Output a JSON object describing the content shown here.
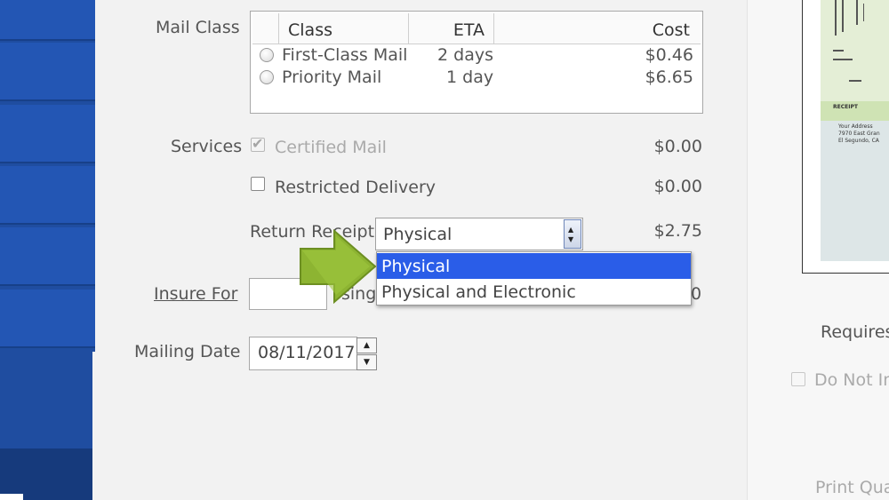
{
  "form": {
    "mail_class_label": "Mail Class",
    "mail_class_table": {
      "headers": [
        "Class",
        "ETA",
        "Cost"
      ],
      "rows": [
        {
          "class": "First-Class Mail",
          "eta": "2 days",
          "cost": "$0.46"
        },
        {
          "class": "Priority Mail",
          "eta": "1 day",
          "cost": "$6.65"
        }
      ]
    },
    "services_label": "Services",
    "certified_mail": {
      "label": "Certified Mail",
      "price": "$0.00",
      "checked": true,
      "disabled": true
    },
    "restricted_delivery": {
      "label": "Restricted Delivery",
      "price": "$0.00",
      "checked": false
    },
    "return_receipt": {
      "label": "Return Receipt",
      "selected": "Physical",
      "price": "$2.75",
      "options": [
        "Physical",
        "Physical and Electronic"
      ]
    },
    "insure_for": {
      "label": "Insure For",
      "value": "",
      "partial_text": "sing",
      "partial_price": "0"
    },
    "mailing_date": {
      "label": "Mailing Date",
      "value": "08/11/2017"
    }
  },
  "right_panel": {
    "preview_receipt_label": "RECEIPT",
    "preview_address_lines": [
      "Your Address",
      "7970 East Gran",
      "El Segundo, CA"
    ],
    "requires_label": "Requires",
    "do_not_label": "Do Not In",
    "print_label": "Print Qua"
  },
  "icons": {
    "pointer_arrow": "green-arrow-icon",
    "select_spinner": "updown-icon",
    "stepper_up": "up-icon",
    "stepper_down": "down-icon"
  },
  "colors": {
    "sidebar": "#1f4da0",
    "selection": "#2a5de8",
    "arrow": "#8db432"
  }
}
